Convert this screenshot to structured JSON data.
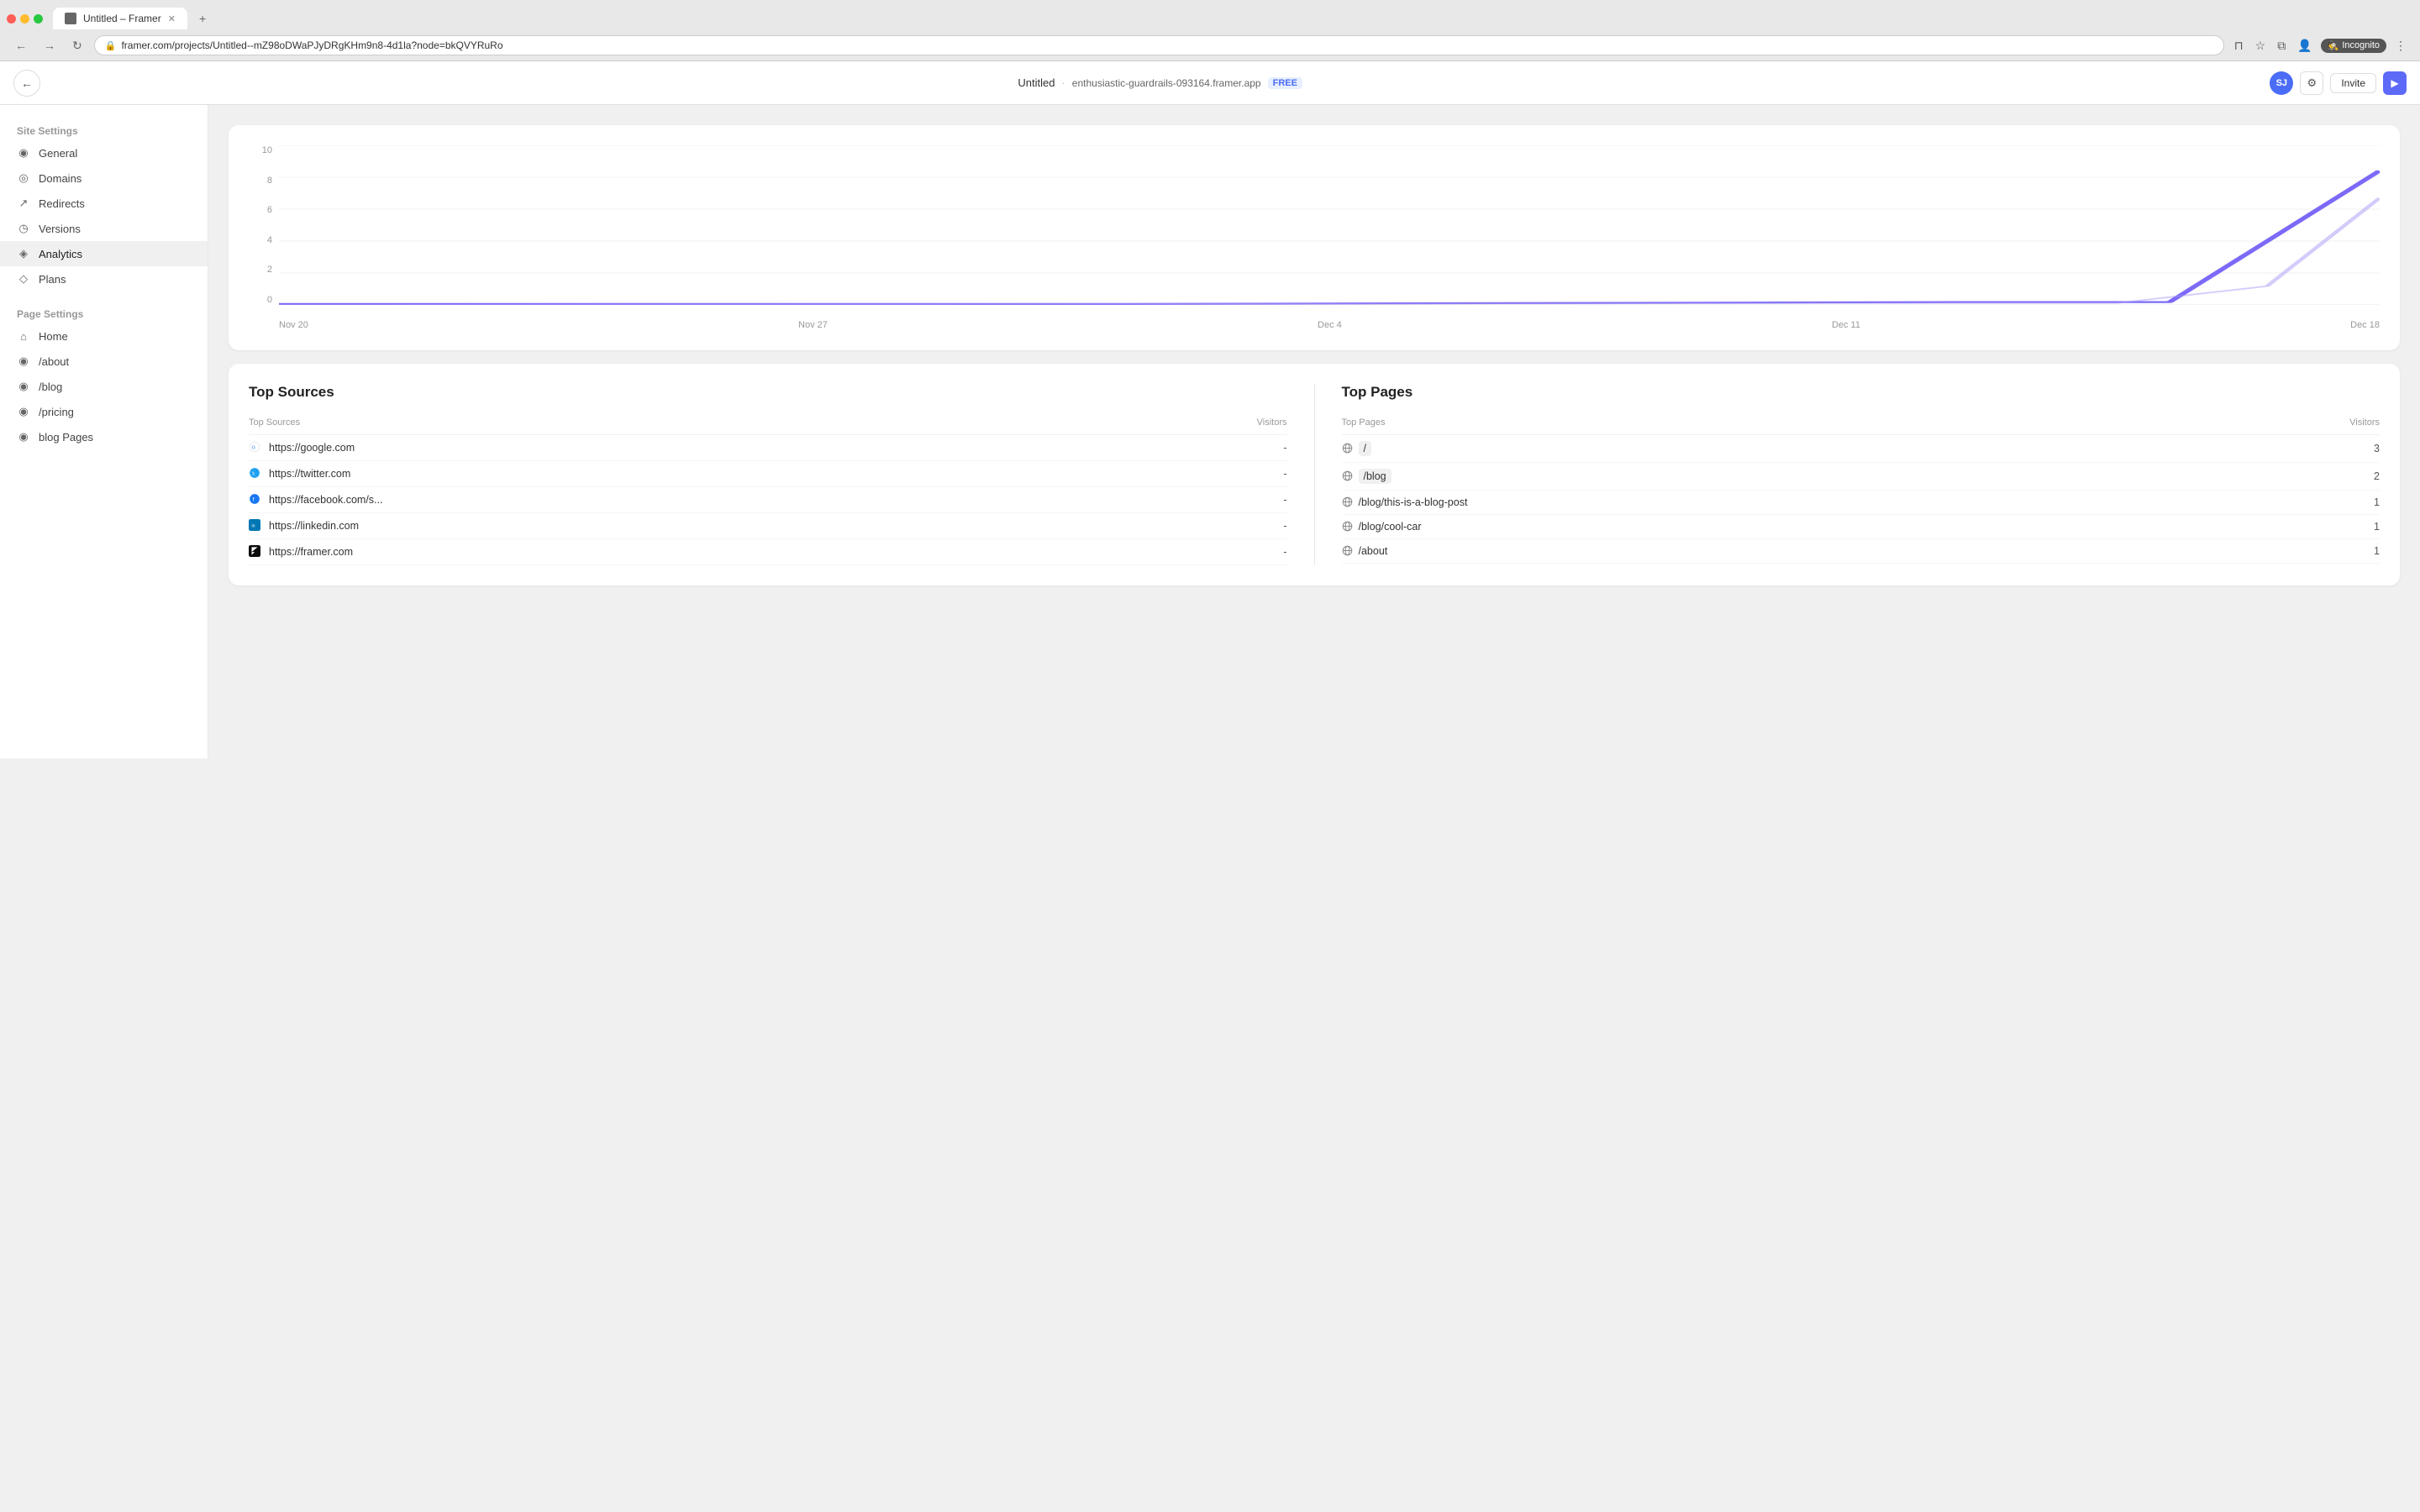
{
  "browser": {
    "tab_title": "Untitled – Framer",
    "url": "framer.com/projects/Untitled--mZ98oDWaPJyDRgKHm9n8-4d1la?node=bkQVYRuRo",
    "nav_back": "←",
    "nav_forward": "→",
    "nav_reload": "↻",
    "incognito_label": "Incognito",
    "new_tab": "+"
  },
  "header": {
    "back_icon": "←",
    "title": "Untitled",
    "separator": "·",
    "domain": "enthusiastic-guardrails-093164.framer.app",
    "badge": "FREE",
    "avatar": "SJ",
    "invite_label": "Invite",
    "settings_icon": "⚙",
    "play_icon": "▶"
  },
  "sidebar": {
    "site_settings_label": "Site Settings",
    "items_site": [
      {
        "id": "general",
        "label": "General",
        "icon": "◉"
      },
      {
        "id": "domains",
        "label": "Domains",
        "icon": "◎"
      },
      {
        "id": "redirects",
        "label": "Redirects",
        "icon": "↗"
      },
      {
        "id": "versions",
        "label": "Versions",
        "icon": "◷"
      },
      {
        "id": "analytics",
        "label": "Analytics",
        "icon": "◈",
        "active": true
      },
      {
        "id": "plans",
        "label": "Plans",
        "icon": "◇"
      }
    ],
    "page_settings_label": "Page Settings",
    "items_page": [
      {
        "id": "home",
        "label": "Home",
        "icon": "⌂"
      },
      {
        "id": "about",
        "label": "/about",
        "icon": "◉"
      },
      {
        "id": "blog",
        "label": "/blog",
        "icon": "◉"
      },
      {
        "id": "pricing",
        "label": "/pricing",
        "icon": "◉"
      },
      {
        "id": "blog-pages",
        "label": "blog Pages",
        "icon": "◉"
      }
    ]
  },
  "chart": {
    "y_labels": [
      "0",
      "2",
      "4",
      "6",
      "8",
      "10"
    ],
    "x_labels": [
      "Nov 20",
      "Nov 27",
      "Dec 4",
      "Dec 11",
      "Dec 18"
    ]
  },
  "top_sources": {
    "title": "Top Sources",
    "col_source": "Top Sources",
    "col_visitors": "Visitors",
    "rows": [
      {
        "name": "https://google.com",
        "icon": "google",
        "visitors": "-"
      },
      {
        "name": "https://twitter.com",
        "icon": "twitter",
        "visitors": "-"
      },
      {
        "name": "https://facebook.com/s...",
        "icon": "facebook",
        "visitors": "-"
      },
      {
        "name": "https://linkedin.com",
        "icon": "linkedin",
        "visitors": "-"
      },
      {
        "name": "https://framer.com",
        "icon": "framer",
        "visitors": "-"
      }
    ]
  },
  "top_pages": {
    "title": "Top Pages",
    "col_page": "Top Pages",
    "col_visitors": "Visitors",
    "rows": [
      {
        "page": "/",
        "visitors": "3",
        "highlight": true
      },
      {
        "page": "/blog",
        "visitors": "2",
        "highlight": true
      },
      {
        "page": "/blog/this-is-a-blog-post",
        "visitors": "1",
        "highlight": false
      },
      {
        "page": "/blog/cool-car",
        "visitors": "1",
        "highlight": false
      },
      {
        "page": "/about",
        "visitors": "1",
        "highlight": false
      }
    ]
  }
}
